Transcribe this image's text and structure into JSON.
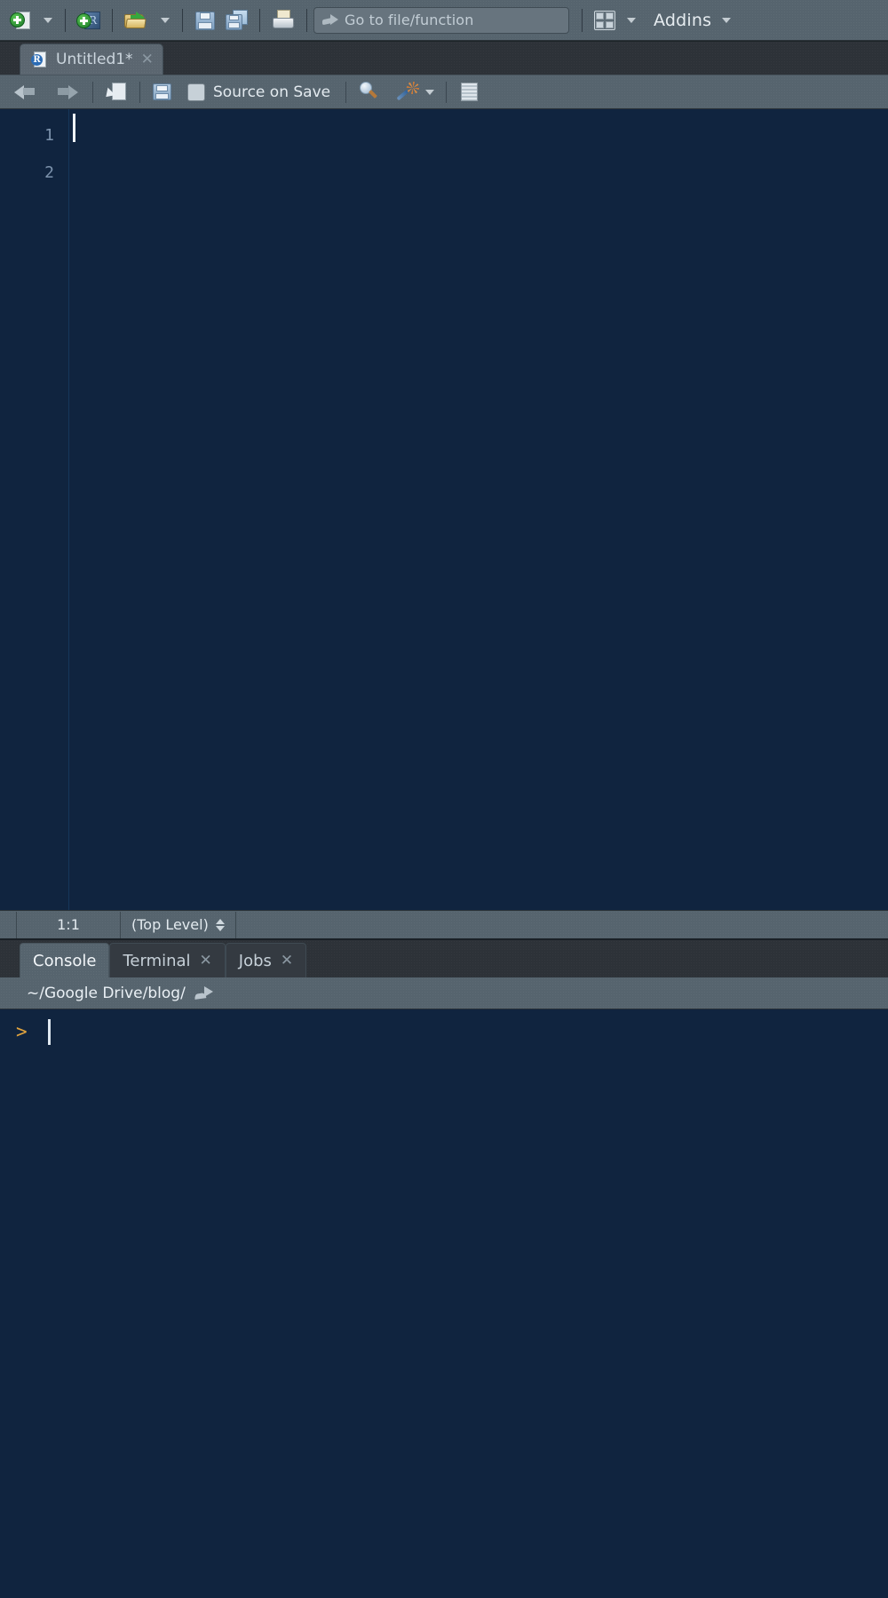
{
  "main_toolbar": {
    "new_file": {
      "name": "New File",
      "icon": "new-file-icon"
    },
    "new_file_menu": {
      "name": "New File menu",
      "icon": "chevron-down-icon"
    },
    "new_project": {
      "name": "New Project",
      "icon": "new-project-icon"
    },
    "open_file": {
      "name": "Open an existing file",
      "icon": "open-folder-icon"
    },
    "open_recent_menu": {
      "name": "Open recent files",
      "icon": "chevron-down-icon"
    },
    "save": {
      "name": "Save current document",
      "icon": "save-icon"
    },
    "save_all": {
      "name": "Save all open documents",
      "icon": "save-all-icon"
    },
    "print": {
      "name": "Print current document",
      "icon": "print-icon"
    },
    "goto": {
      "icon": "goto-arrow-icon",
      "placeholder": "Go to file/function",
      "value": ""
    },
    "pane_layout": {
      "name": "Workspace panes",
      "icon": "panes-layout-icon"
    },
    "pane_layout_menu": {
      "icon": "chevron-down-icon"
    },
    "addins_label": "Addins",
    "addins_menu_icon": "chevron-down-icon"
  },
  "source_pane": {
    "tabs": [
      {
        "label": "Untitled1*",
        "icon": "r-script-file-icon",
        "close_icon": "close-icon",
        "active": true
      }
    ],
    "toolbar": {
      "back": {
        "name": "Back",
        "icon": "arrow-left-icon"
      },
      "forward": {
        "name": "Forward",
        "icon": "arrow-right-icon"
      },
      "show_in_new_window": {
        "name": "Show in new window",
        "icon": "show-in-new-window-icon"
      },
      "save": {
        "name": "Save current document",
        "icon": "save-icon"
      },
      "source_on_save_label": "Source on Save",
      "source_on_save_checked": false,
      "find_replace": {
        "name": "Find/Replace",
        "icon": "magnifier-icon"
      },
      "code_tools": {
        "name": "Code Tools",
        "icon": "magic-wand-icon"
      },
      "code_tools_menu_icon": "chevron-down-icon",
      "compile_report": {
        "name": "Compile Report",
        "icon": "compile-report-icon"
      }
    },
    "editor": {
      "line_numbers": [
        "1",
        "2"
      ],
      "lines": [
        "",
        ""
      ],
      "cursor_line": 1,
      "cursor_column": 1
    },
    "status": {
      "position": "1:1",
      "scope": "(Top Level)",
      "scope_menu_icon": "up-down-arrows-icon"
    }
  },
  "console_pane": {
    "tabs": [
      {
        "label": "Console",
        "active": true,
        "closable": false
      },
      {
        "label": "Terminal",
        "active": false,
        "closable": true,
        "close_icon": "close-icon"
      },
      {
        "label": "Jobs",
        "active": false,
        "closable": true,
        "close_icon": "close-icon"
      }
    ],
    "working_directory": "~/Google Drive/blog/",
    "open_in_new_window_icon": "external-link-icon",
    "prompt_symbol": ">",
    "prompt_value": "",
    "output_lines": []
  },
  "colors": {
    "toolbar_bg": "#56646e",
    "tabbar_bg": "#2d3238",
    "editor_bg": "#10243f",
    "accent_prompt": "#e0a33e",
    "text_primary": "#e3eaef",
    "line_number": "#7d93ad"
  }
}
